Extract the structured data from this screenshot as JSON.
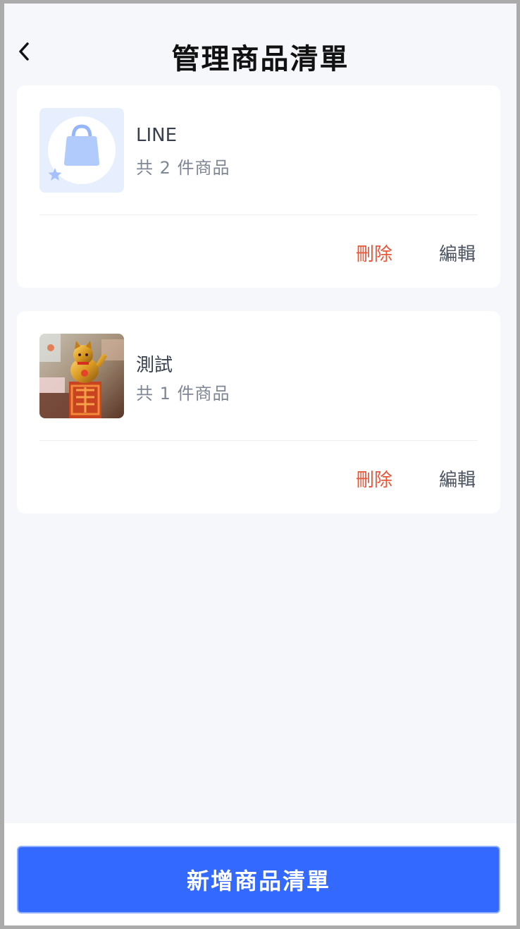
{
  "header": {
    "title": "管理商品清單",
    "back_icon": "chevron-left-icon"
  },
  "lists": [
    {
      "name": "LINE",
      "count_label": "共 2 件商品",
      "thumbnail": "shopping-bag-placeholder",
      "delete_label": "刪除",
      "edit_label": "編輯"
    },
    {
      "name": "測試",
      "count_label": "共 1 件商品",
      "thumbnail": "lucky-cat-photo",
      "delete_label": "刪除",
      "edit_label": "編輯"
    }
  ],
  "footer": {
    "add_label": "新增商品清單"
  },
  "colors": {
    "primary": "#3369fe",
    "danger": "#e8573a",
    "background": "#f6f7fb"
  }
}
